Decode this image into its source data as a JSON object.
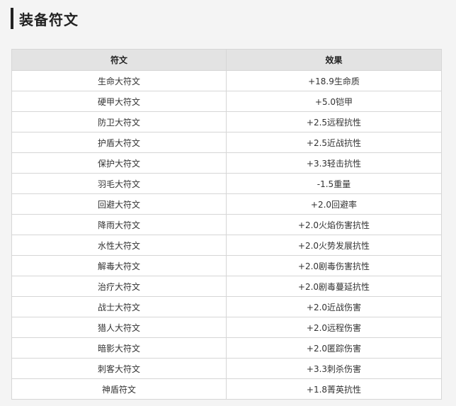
{
  "page": {
    "title": "装备符文"
  },
  "table": {
    "headers": [
      "符文",
      "效果"
    ],
    "rows": [
      [
        "生命大符文",
        "+18.9生命质"
      ],
      [
        "硬甲大符文",
        "+5.0铠甲"
      ],
      [
        "防卫大符文",
        "+2.5远程抗性"
      ],
      [
        "护盾大符文",
        "+2.5近战抗性"
      ],
      [
        "保护大符文",
        "+3.3轻击抗性"
      ],
      [
        "羽毛大符文",
        "-1.5重量"
      ],
      [
        "回避大符文",
        "+2.0回避率"
      ],
      [
        "降雨大符文",
        "+2.0火焰伤害抗性"
      ],
      [
        "水性大符文",
        "+2.0火势发展抗性"
      ],
      [
        "解毒大符文",
        "+2.0剧毒伤害抗性"
      ],
      [
        "治疗大符文",
        "+2.0剧毒蔓延抗性"
      ],
      [
        "战士大符文",
        "+2.0近战伤害"
      ],
      [
        "猎人大符文",
        "+2.0远程伤害"
      ],
      [
        "暗影大符文",
        "+2.0匿踪伤害"
      ],
      [
        "刺客大符文",
        "+3.3刺杀伤害"
      ],
      [
        "神盾符文",
        "+1.8菁英抗性"
      ]
    ]
  }
}
